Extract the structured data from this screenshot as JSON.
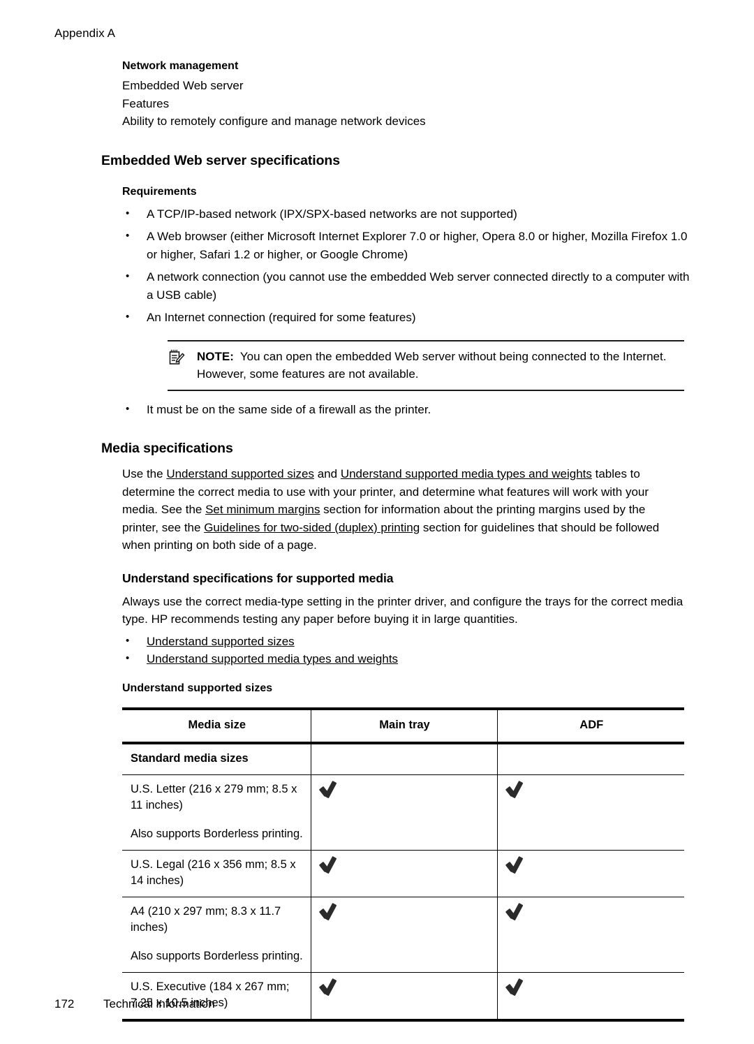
{
  "running_head": "Appendix A",
  "network_management": {
    "heading": "Network management",
    "lines": [
      "Embedded Web server",
      "Features",
      "Ability to remotely configure and manage network devices"
    ]
  },
  "ews": {
    "heading": "Embedded Web server specifications",
    "requirements_heading": "Requirements",
    "requirements": [
      "A TCP/IP-based network (IPX/SPX-based networks are not supported)",
      "A Web browser (either Microsoft Internet Explorer 7.0 or higher, Opera 8.0 or higher, Mozilla Firefox 1.0 or higher, Safari 1.2 or higher, or Google Chrome)",
      "A network connection (you cannot use the embedded Web server connected directly to a computer with a USB cable)",
      "An Internet connection (required for some features)"
    ],
    "note": {
      "label": "NOTE:",
      "text": "You can open the embedded Web server without being connected to the Internet. However, some features are not available.",
      "icon": "note-pad-pencil-icon"
    },
    "requirement_after_note": "It must be on the same side of a firewall as the printer."
  },
  "media_specs": {
    "heading": "Media specifications",
    "paragraph": {
      "p1": "Use the ",
      "link1": "Understand supported sizes",
      "p2": " and ",
      "link2": "Understand supported media types and weights",
      "p3": " tables to determine the correct media to use with your printer, and determine what features will work with your media. See the ",
      "link3": "Set minimum margins",
      "p4": " section for information about the printing margins used by the printer, see the ",
      "link4": "Guidelines for two-sided (duplex) printing",
      "p5": " section for guidelines that should be followed when printing on both side of a page."
    }
  },
  "understand_specs": {
    "heading": "Understand specifications for supported media",
    "paragraph": "Always use the correct media-type setting in the printer driver, and configure the trays for the correct media type. HP recommends testing any paper before buying it in large quantities.",
    "links": [
      "Understand supported sizes",
      "Understand supported media types and weights"
    ]
  },
  "supported_sizes": {
    "heading": "Understand supported sizes",
    "table": {
      "columns": [
        "Media size",
        "Main tray",
        "ADF"
      ],
      "group_label": "Standard media sizes",
      "rows": [
        {
          "media": "U.S. Letter (216 x 279 mm; 8.5 x 11 inches)",
          "note": "Also supports Borderless printing.",
          "main_tray": "check",
          "adf": "check"
        },
        {
          "media": "U.S. Legal (216 x 356 mm; 8.5 x 14 inches)",
          "note": "",
          "main_tray": "check",
          "adf": "check"
        },
        {
          "media": "A4 (210 x 297 mm; 8.3 x 11.7 inches)",
          "note": "Also supports Borderless printing.",
          "main_tray": "check",
          "adf": "check"
        },
        {
          "media": "U.S. Executive (184 x 267 mm; 7.25 x 10.5 inches)",
          "note": "",
          "main_tray": "check",
          "adf": "check"
        }
      ]
    }
  },
  "footer": {
    "page_number": "172",
    "section": "Technical information"
  }
}
